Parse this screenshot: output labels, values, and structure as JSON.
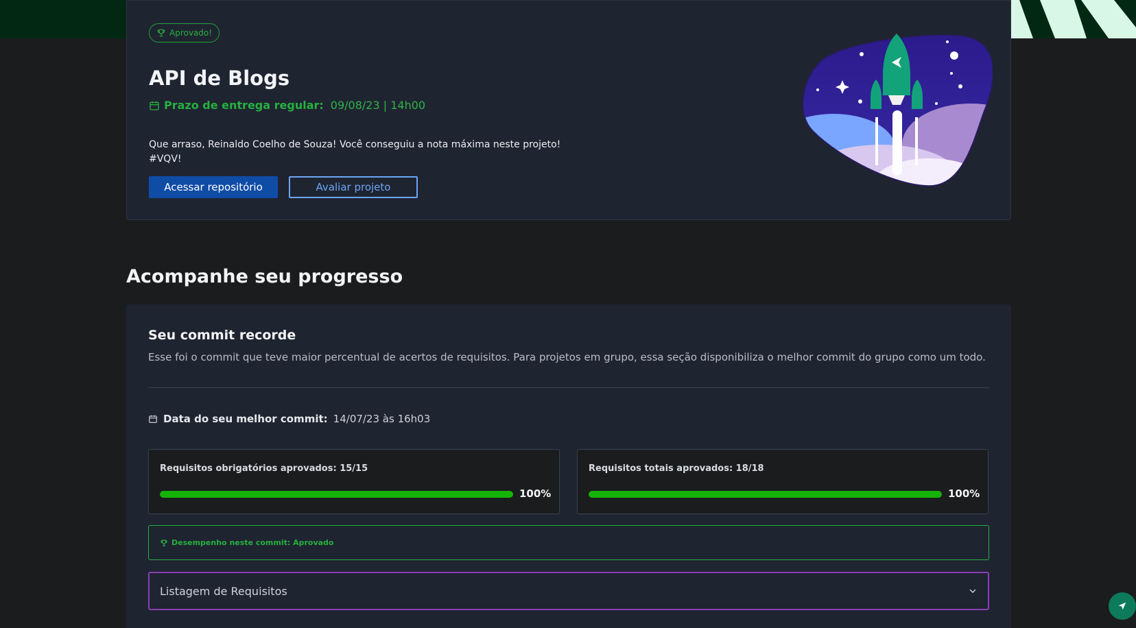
{
  "project": {
    "badge": "Aprovado!",
    "title": "API de Blogs",
    "deadline_label": "Prazo de entrega regular:",
    "deadline_value": "09/08/23 | 14h00",
    "congrats_line1": "Que arraso, Reinaldo Coelho de Souza! Você conseguiu a nota máxima neste projeto!",
    "congrats_line2": "#VQV!",
    "primary_button": "Acessar repositório",
    "secondary_button": "Avaliar projeto"
  },
  "progress": {
    "section_title": "Acompanhe seu progresso",
    "commit_title": "Seu commit recorde",
    "commit_description": "Esse foi o commit que teve maior percentual de acertos de requisitos. Para projetos em grupo, essa seção disponibiliza o melhor commit do grupo como um todo.",
    "best_commit_label": "Data do seu melhor commit:",
    "best_commit_value": "14/07/23 às 16h03",
    "mandatory": {
      "label": "Requisitos obrigatórios aprovados: 15/15",
      "percent_text": "100%",
      "percent": 100
    },
    "total": {
      "label": "Requisitos totais aprovados: 18/18",
      "percent_text": "100%",
      "percent": 100
    },
    "performance": "Desempenho neste commit: Aprovado",
    "accordion_label": "Listagem de Requisitos"
  },
  "colors": {
    "success": "#26b03f",
    "primary": "#0f4ca6",
    "accordion_border": "#8a3fb3",
    "progress_fill": "#15b307"
  },
  "icons": {
    "badge": "trophy-icon",
    "deadline": "calendar-icon",
    "best_commit": "calendar-icon",
    "performance": "trophy-icon",
    "accordion": "chevron-down-icon",
    "fab": "rocket-icon"
  }
}
